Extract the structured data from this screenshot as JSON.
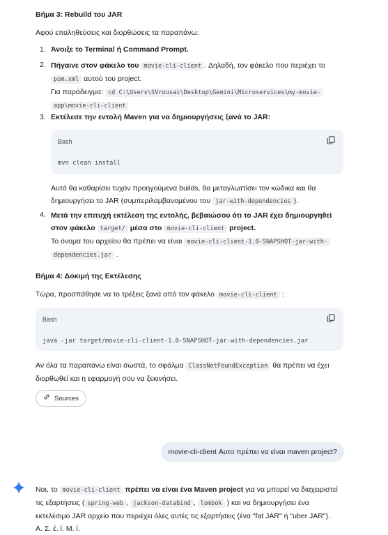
{
  "step3": {
    "heading": "Βήμα 3: Rebuild του JAR",
    "intro": "Αφού επαληθεύσεις και διορθώσεις τα παραπάνω:",
    "items": [
      {
        "num": "1.",
        "bold": "Άνοιξε το Terminal ή Command Prompt."
      },
      {
        "num": "2.",
        "bold": "Πήγαινε στον φάκελο του",
        "code1": "movie-cli-client",
        "text1": ". Δηλαδή, τον φάκελο που περιέχει το",
        "code2": "pom.xml",
        "text2": "αυτού του project.",
        "example_label": "Για παράδειγμα:",
        "example_code_line1": "cd C:\\Users\\SVrousai\\Desktop\\Gemini\\Microservices\\my-movie-",
        "example_code_line2": "app\\movie-cli-client"
      },
      {
        "num": "3.",
        "bold": "Εκτέλεσε την εντολή Maven για να δημιουργήσεις ξανά το JAR:"
      },
      {
        "num": "4.",
        "bold1": "Μετά την επιτυχή εκτέλεση της εντολής, βεβαιώσου ότι το JAR έχει δημιουργηθεί",
        "bold2": "στον φάκελο",
        "code1": "target/",
        "bold3": "μέσα στο",
        "code2": "movie-cli-client",
        "bold4": "project.",
        "text1": "Το όνομα του αρχείου θα πρέπει να είναι",
        "code3_line1": "movie-cli-client-1.0-SNAPSHOT-jar-with-",
        "code3_line2": "dependencies.jar"
      }
    ],
    "codeblock": {
      "lang": "Bash",
      "code": "mvn clean install"
    },
    "after_code_line1": "Αυτό θα καθαρίσει τυχόν προηγούμενα builds, θα μεταγλωττίσει τον κώδικα και θα",
    "after_code_line2_a": "δημιουργήσει το JAR (συμπεριλαμβανομένου του",
    "after_code_code": "jar-with-dependencies",
    "after_code_line2_b": ")."
  },
  "step4": {
    "heading": "Βήμα 4: Δοκιμή της Εκτέλεσης",
    "intro_a": "Τώρα, προσπάθησε να το τρέξεις ξανά από τον φάκελο",
    "intro_code": "movie-cli-client",
    "intro_b": ":",
    "codeblock": {
      "lang": "Bash",
      "code": "java -jar target/movie-cli-client-1.0-SNAPSHOT-jar-with-dependencies.jar"
    },
    "outro_a": "Αν όλα τα παραπάνω είναι σωστά, το σφάλμα",
    "outro_code": "ClassNotFoundException",
    "outro_b": "θα πρέπει να έχει",
    "outro_line2": "διορθωθεί και η εφαρμογή σου να ξεκινήσει."
  },
  "sources_button": "Sources",
  "user_message": "movie-cli-client Αυτο πρέπει να είναι maven project?",
  "reply": {
    "a": "Ναι, το",
    "code1": "movie-cli-client",
    "bold": "πρέπει να είναι ένα Maven project",
    "b": "για να μπορεί να διαχειριστεί",
    "line2_a": "τις εξαρτήσεις (",
    "code2": "spring-web",
    "sep1": ",",
    "code3": "jackson-databind",
    "sep2": ",",
    "code4": "lombok",
    "line2_b": ") και να δημιουργήσει ένα",
    "line3": "εκτελέσιμο JAR αρχείο που περιέχει όλες αυτές τις εξαρτήσεις (ένα \"fat JAR\" ή \"uber JAR\").",
    "cut_line": "Α. Σ. έ. ί. Μ. ί."
  },
  "colors": {
    "accent": "#1a73e8",
    "code_bg": "#f0f4f9",
    "user_bubble": "#e9eef6"
  }
}
